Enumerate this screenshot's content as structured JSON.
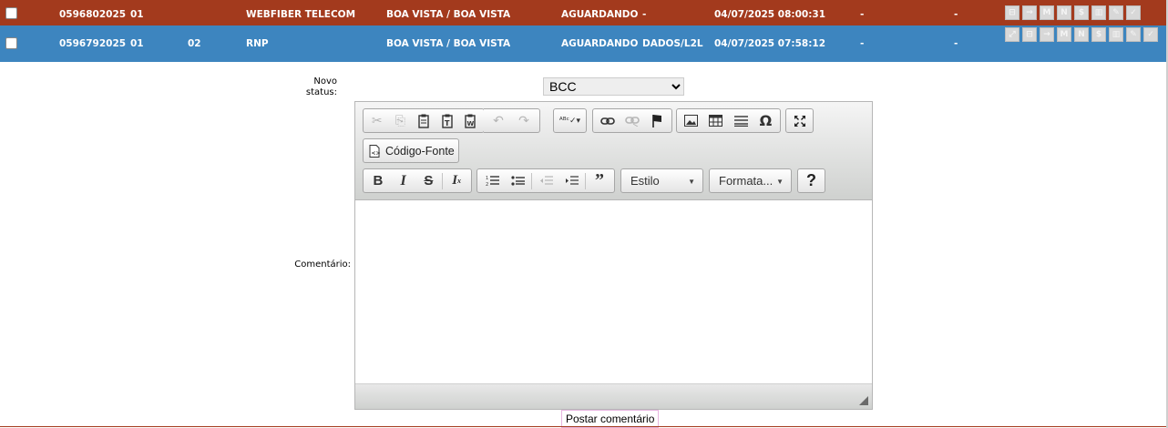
{
  "rows": [
    {
      "protocol": "0596802025",
      "seq": "01",
      "sub": "",
      "client": "WEBFIBER TELECOM",
      "city": "BOA VISTA / BOA VISTA",
      "status": "AGUARDANDO",
      "service": "-",
      "datetime": "04/07/2025 08:00:31",
      "col9": "-",
      "col10": "-",
      "actions": [
        "⊟",
        "→",
        "M",
        "N",
        "$",
        "▥",
        "✎",
        "✓"
      ]
    },
    {
      "protocol": "0596792025",
      "seq": "01",
      "sub": "02",
      "client": "RNP",
      "city": "BOA VISTA / BOA VISTA",
      "status": "AGUARDANDO",
      "service": "DADOS/L2L",
      "datetime": "04/07/2025 07:58:12",
      "col9": "-",
      "col10": "-",
      "actions": [
        "⤢",
        "⊟",
        "→",
        "M",
        "N",
        "$",
        "▥",
        "✎",
        "✓"
      ]
    }
  ],
  "colors": {
    "row_alert": "#a33a1d",
    "row_selected": "#3d85bf"
  },
  "form": {
    "status_label": "Novo status:",
    "status_value": "BCC",
    "comment_label": "Comentário:",
    "post_button": "Postar comentário"
  },
  "editor": {
    "source_button": "Código-Fonte",
    "style_combo": "Estilo",
    "format_combo": "Formata...",
    "help": "?"
  }
}
